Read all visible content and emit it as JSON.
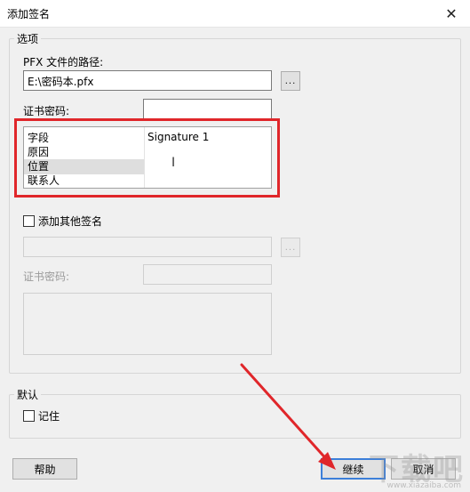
{
  "window": {
    "title": "添加签名"
  },
  "options_group": {
    "label": "选项",
    "pfx_path_label": "PFX 文件的路径:",
    "pfx_path_value": "E:\\密码本.pfx",
    "browse_label": "...",
    "cert_password_label": "证书密码:",
    "cert_password_value": "",
    "fields": [
      "字段",
      "原因",
      "位置",
      "联系人"
    ],
    "selected_value": "Signature 1",
    "add_other_label": "添加其他签名",
    "browse2_label": "...",
    "cert_password2_label": "证书密码:"
  },
  "default_group": {
    "label": "默认",
    "remember_label": "记住"
  },
  "buttons": {
    "help": "帮助",
    "continue": "继续",
    "cancel": "取消"
  },
  "watermark": {
    "text": "下载吧",
    "sub": "www.xiazaiba.com"
  },
  "colors": {
    "annotation": "#e0262a",
    "focus": "#3c7fd9"
  }
}
